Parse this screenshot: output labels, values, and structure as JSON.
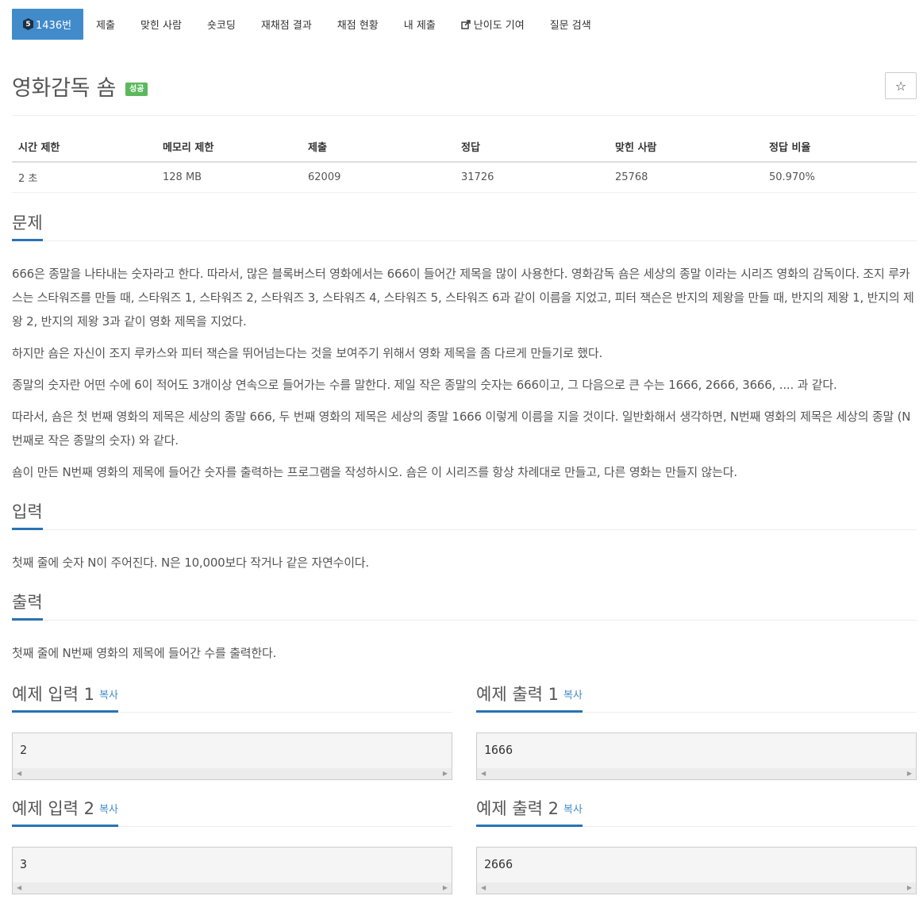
{
  "nav": {
    "tier_label": "5",
    "items": [
      "1436번",
      "제출",
      "맞힌 사람",
      "숏코딩",
      "재채점 결과",
      "채점 현황",
      "내 제출",
      "난이도 기여",
      "질문 검색"
    ]
  },
  "problem": {
    "title": "영화감독 숌",
    "badge": "성공",
    "star": "☆"
  },
  "info": {
    "headers": [
      "시간 제한",
      "메모리 제한",
      "제출",
      "정답",
      "맞힌 사람",
      "정답 비율"
    ],
    "values": [
      "2 초",
      "128 MB",
      "62009",
      "31726",
      "25768",
      "50.970%"
    ]
  },
  "sections": {
    "problem_heading": "문제",
    "problem_paras": [
      "666은 종말을 나타내는 숫자라고 한다. 따라서, 많은 블록버스터 영화에서는 666이 들어간 제목을 많이 사용한다. 영화감독 숌은 세상의 종말 이라는 시리즈 영화의 감독이다. 조지 루카스는 스타워즈를 만들 때, 스타워즈 1, 스타워즈 2, 스타워즈 3, 스타워즈 4, 스타워즈 5, 스타워즈 6과 같이 이름을 지었고, 피터 잭슨은 반지의 제왕을 만들 때, 반지의 제왕 1, 반지의 제왕 2, 반지의 제왕 3과 같이 영화 제목을 지었다.",
      "하지만 숌은 자신이 조지 루카스와 피터 잭슨을 뛰어넘는다는 것을 보여주기 위해서 영화 제목을 좀 다르게 만들기로 했다.",
      "종말의 숫자란 어떤 수에 6이 적어도 3개이상 연속으로 들어가는 수를 말한다. 제일 작은 종말의 숫자는 666이고, 그 다음으로 큰 수는 1666, 2666, 3666, .... 과 같다.",
      "따라서, 숌은 첫 번째 영화의 제목은 세상의 종말 666, 두 번째 영화의 제목은 세상의 종말 1666 이렇게 이름을 지을 것이다. 일반화해서 생각하면, N번째 영화의 제목은 세상의 종말 (N번째로 작은 종말의 숫자) 와 같다.",
      "숌이 만든 N번째 영화의 제목에 들어간 숫자를 출력하는 프로그램을 작성하시오. 숌은 이 시리즈를 항상 차례대로 만들고, 다른 영화는 만들지 않는다."
    ],
    "input_heading": "입력",
    "input_text": "첫째 줄에 숫자 N이 주어진다. N은 10,000보다 작거나 같은 자연수이다.",
    "output_heading": "출력",
    "output_text": "첫째 줄에 N번째 영화의 제목에 들어간 수를 출력한다."
  },
  "samples": {
    "copy_label": "복사",
    "input1_heading": "예제 입력 1",
    "output1_heading": "예제 출력 1",
    "input2_heading": "예제 입력 2",
    "output2_heading": "예제 출력 2",
    "input1": "2",
    "output1": "1666",
    "input2": "3",
    "output2": "2666"
  }
}
